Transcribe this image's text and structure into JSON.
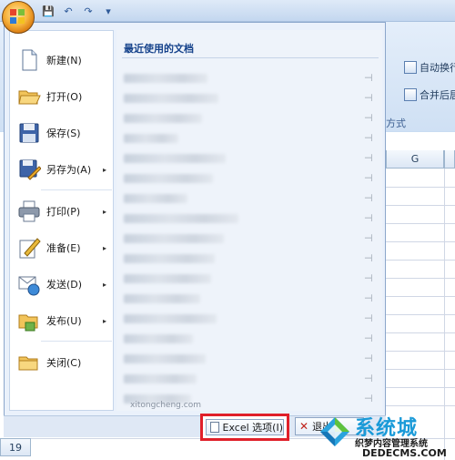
{
  "qat": {
    "save": "💾",
    "undo": "↶",
    "redo": "↷",
    "more": "▾"
  },
  "ribbon": {
    "btn_wrap_text": "自动换行",
    "btn_merge_center": "合并后居",
    "group_label": "方式"
  },
  "sheet": {
    "col_g": "G",
    "row_19": "19"
  },
  "menu": {
    "items": [
      {
        "label": "新建(N)",
        "icon": "new-document-icon"
      },
      {
        "label": "打开(O)",
        "icon": "open-folder-icon"
      },
      {
        "label": "保存(S)",
        "icon": "save-disk-icon"
      },
      {
        "label": "另存为(A)",
        "icon": "save-as-icon",
        "arrow": "▸"
      },
      {
        "label": "打印(P)",
        "icon": "printer-icon",
        "arrow": "▸"
      },
      {
        "label": "准备(E)",
        "icon": "prepare-pen-icon",
        "arrow": "▸"
      },
      {
        "label": "发送(D)",
        "icon": "send-icon",
        "arrow": "▸"
      },
      {
        "label": "发布(U)",
        "icon": "publish-icon",
        "arrow": "▸"
      },
      {
        "label": "关闭(C)",
        "icon": "close-folder-icon"
      }
    ],
    "recent_title": "最近使用的文档",
    "recent_footer": "xitongcheng.com",
    "pin": "⊣"
  },
  "buttons": {
    "excel_options": "Excel 选项(I)",
    "exit": "退出"
  },
  "watermark": {
    "brand": "系统城",
    "line1": "织梦内容管理系统",
    "line2": "DEDECMS.COM"
  },
  "colors": {
    "highlight": "#e0202a",
    "accent": "#15428b"
  }
}
